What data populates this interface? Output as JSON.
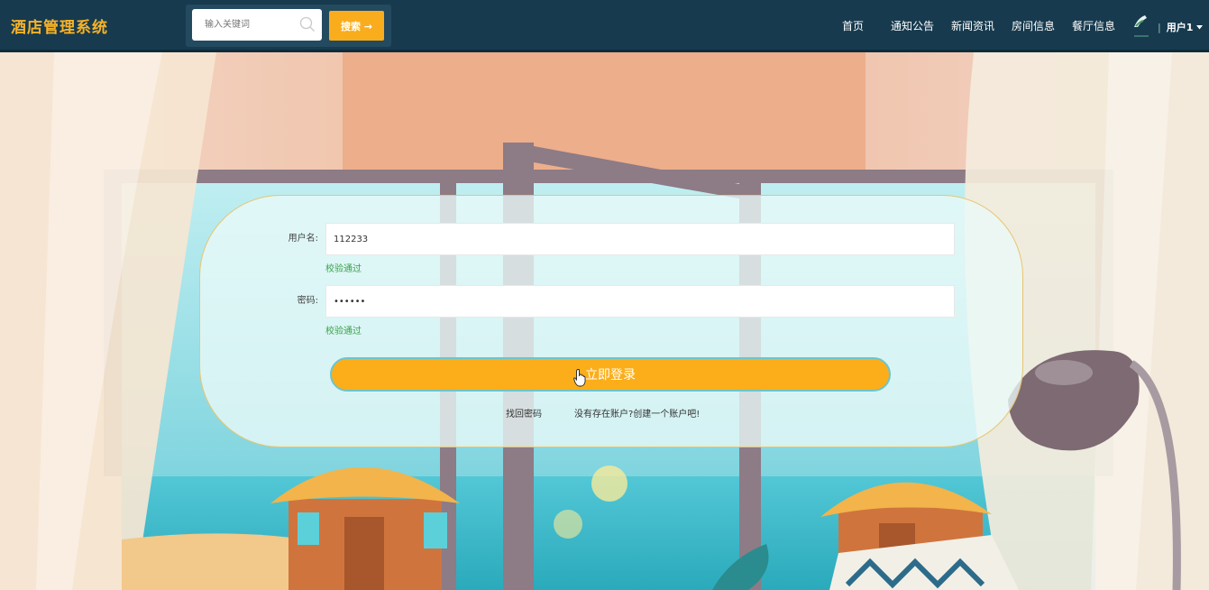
{
  "header": {
    "logo": "酒店管理系统",
    "search": {
      "placeholder": "输入关键词",
      "button_label": "搜索 →"
    },
    "nav": [
      {
        "label": "首页"
      },
      {
        "label": "通知公告"
      },
      {
        "label": "新闻资讯"
      },
      {
        "label": "房间信息"
      },
      {
        "label": "餐厅信息"
      }
    ],
    "user": {
      "name": "用户1",
      "separator": "|",
      "dropdown_icon": "caret-down-icon"
    }
  },
  "login": {
    "username_label": "用户名:",
    "username_value": "112233",
    "username_status": "校验通过",
    "password_label": "密码:",
    "password_value": "••••••",
    "password_status": "校验通过",
    "submit_label": "立即登录",
    "forgot_label": "找回密码",
    "register_label": "没有存在账户?创建一个账户吧!"
  },
  "colors": {
    "navbar": "#173a4e",
    "logo": "#f7b328",
    "accent": "#f9ad1c",
    "success": "#3aa14a"
  }
}
